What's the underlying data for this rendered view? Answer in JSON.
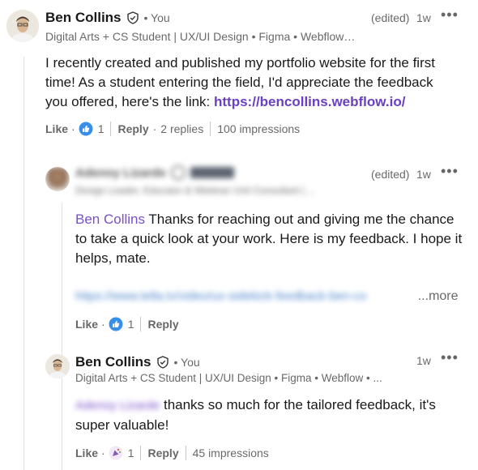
{
  "comment": {
    "author": "Ben Collins",
    "you_label": "• You",
    "edited": "(edited)",
    "time": "1w",
    "headline": "Digital Arts + CS Student | UX/UI Design • Figma • Webflow…",
    "body_text": "I recently created and published my portfolio website for the first time! As a student entering the field, I'd appreciate the feedback you offered, here's the link: ",
    "link": "https://bencollins.webflow.io/",
    "like": "Like",
    "like_count": "1",
    "reply": "Reply",
    "replies": "2 replies",
    "impressions": "100 impressions",
    "more_icon": "more-horizontal-icon"
  },
  "reply1": {
    "author": "Adenoy Lizarde",
    "edited": "(edited)",
    "time": "1w",
    "headline": "Design Leader, Educator & Webinar Unit Consultant | ...",
    "mention": "Ben Collins",
    "body_text": " Thanks for reaching out and giving me the chance to take a quick look at your work. Here is my feedback. I hope it helps, mate.",
    "link": "https://www.tella.tv/video/ux-sidekick-feedback-ben-co",
    "more": "...more",
    "like": "Like",
    "like_count": "1",
    "reply": "Reply"
  },
  "reply2": {
    "author": "Ben Collins",
    "you_label": "• You",
    "time": "1w",
    "headline": "Digital Arts + CS Student | UX/UI Design • Figma • Webflow • ...",
    "mention": "Adenoy Lizarde",
    "body_text": " thanks so much for the tailored feedback, it's super valuable!",
    "like": "Like",
    "like_count": "1",
    "reply": "Reply",
    "impressions": "45 impressions"
  },
  "colors": {
    "link": "#6a3fc1",
    "like_blue": "#0a66c2"
  }
}
